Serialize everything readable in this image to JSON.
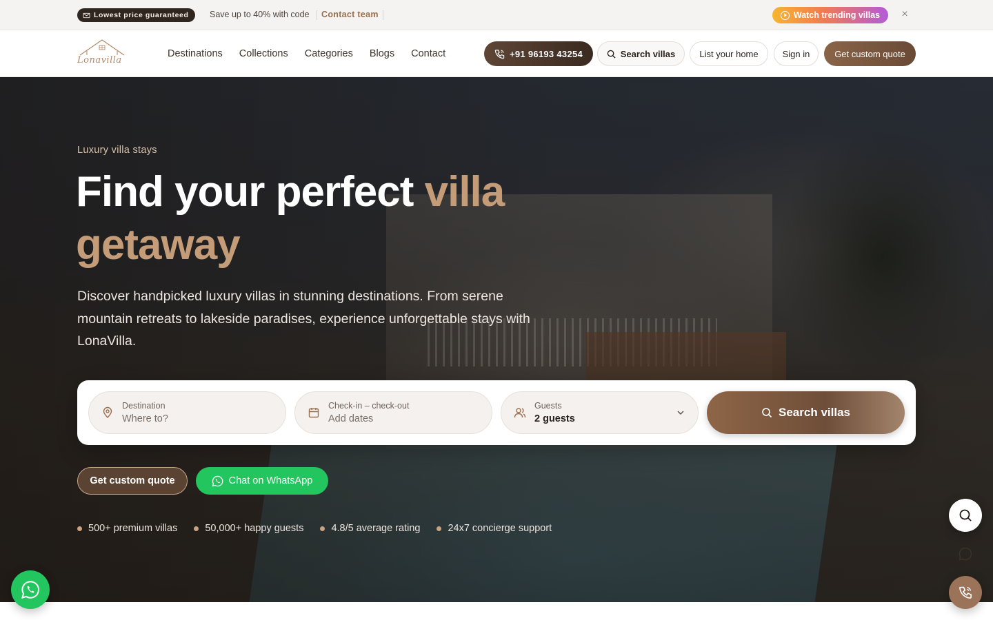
{
  "announcement": {
    "badge": "Lowest price guaranteed",
    "promo": "Save up to 40% with code",
    "contact_link": "Contact team",
    "trending_button": "Watch trending villas",
    "close_glyph": "×"
  },
  "header": {
    "logo_text": "Lonavilla",
    "nav": [
      "Destinations",
      "Collections",
      "Categories",
      "Blogs",
      "Contact"
    ],
    "phone": "+91 96193 43254",
    "search_label": "Search villas",
    "list_home": "List your home",
    "sign_in": "Sign in",
    "custom_quote": "Get custom quote"
  },
  "hero": {
    "eyebrow": "Luxury villa stays",
    "headline_white": "Find your perfect ",
    "headline_accent_1": "villa",
    "headline_accent_2": "getaway",
    "subtext": "Discover handpicked luxury villas in stunning destinations. From serene mountain retreats to lakeside paradises, experience unforgettable stays with LonaVilla."
  },
  "search": {
    "destination_label": "Destination",
    "destination_placeholder": "Where to?",
    "dates_label": "Check-in – check-out",
    "dates_placeholder": "Add dates",
    "guests_label": "Guests",
    "guests_value": "2 guests",
    "button": "Search villas"
  },
  "ctas": {
    "quote": "Get custom quote",
    "whatsapp": "Chat on WhatsApp"
  },
  "stats": [
    "500+ premium villas",
    "50,000+ happy guests",
    "4.8/5 average rating",
    "24x7 concierge support"
  ],
  "colors": {
    "accent": "#c59c78",
    "brand_brown": "#6f4e39",
    "whatsapp_green": "#22c55e"
  },
  "icons": [
    "mail-icon",
    "play-circle-icon",
    "close-icon",
    "phone-icon",
    "search-icon",
    "map-pin-icon",
    "calendar-icon",
    "users-icon",
    "chevron-down-icon",
    "whatsapp-icon",
    "chat-bubble-icon"
  ]
}
